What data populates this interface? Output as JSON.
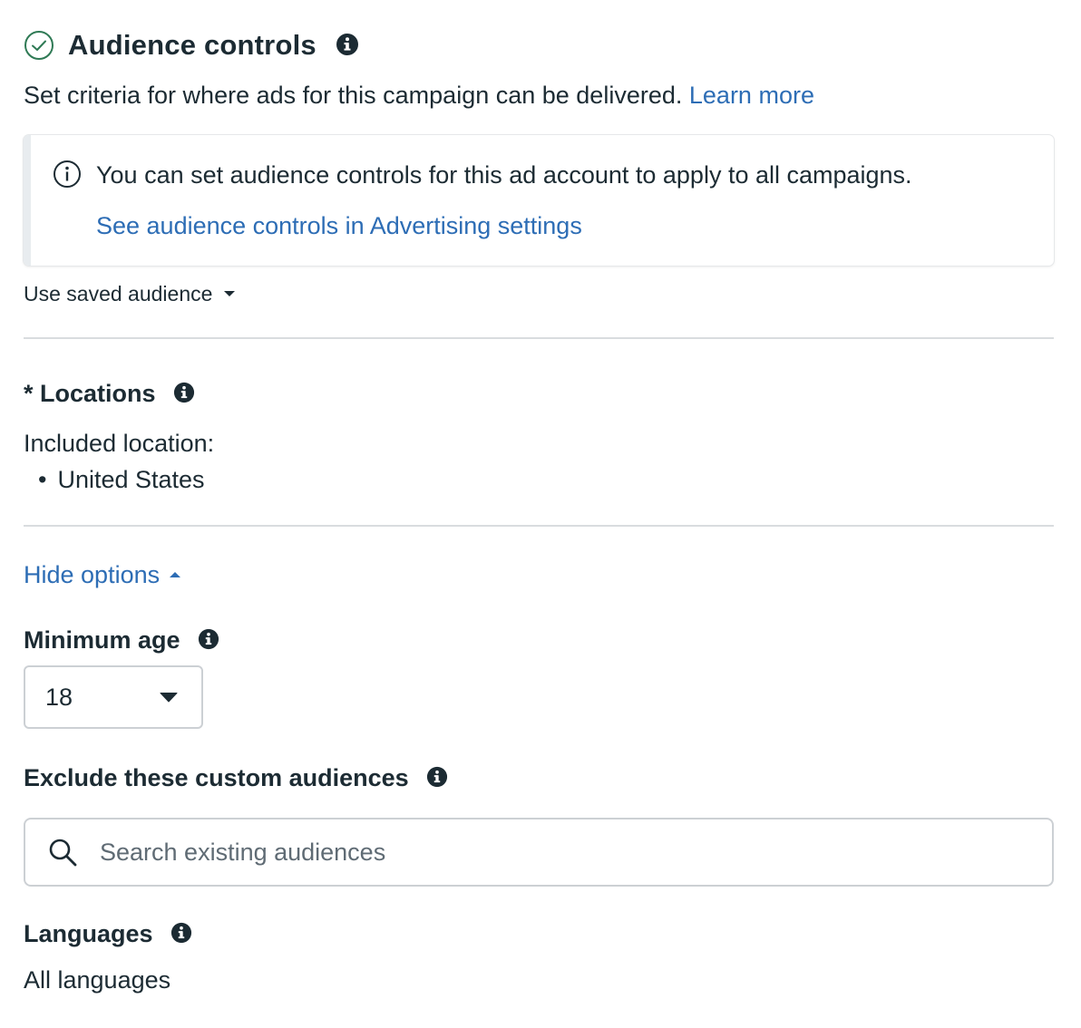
{
  "header": {
    "title": "Audience controls",
    "description": "Set criteria for where ads for this campaign can be delivered.",
    "learn_more": "Learn more"
  },
  "notice": {
    "text": "You can set audience controls for this ad account to apply to all campaigns.",
    "link": "See audience controls in Advertising settings"
  },
  "saved_audience": {
    "label": "Use saved audience"
  },
  "locations": {
    "title": "Locations",
    "required_marker": "*",
    "included_label": "Included location:",
    "items": [
      "United States"
    ]
  },
  "options_toggle": {
    "label": "Hide options"
  },
  "minimum_age": {
    "title": "Minimum age",
    "value": "18"
  },
  "exclude_audiences": {
    "title": "Exclude these custom audiences",
    "search_placeholder": "Search existing audiences"
  },
  "languages": {
    "title": "Languages",
    "value": "All languages"
  },
  "colors": {
    "link": "#2d6db5",
    "text": "#1c2b33",
    "success": "#2f7a55",
    "divider": "#d9dcdf"
  },
  "icons": [
    "check-circle-icon",
    "info-icon",
    "info-outline-icon",
    "caret-down-icon",
    "caret-up-icon",
    "search-icon"
  ]
}
